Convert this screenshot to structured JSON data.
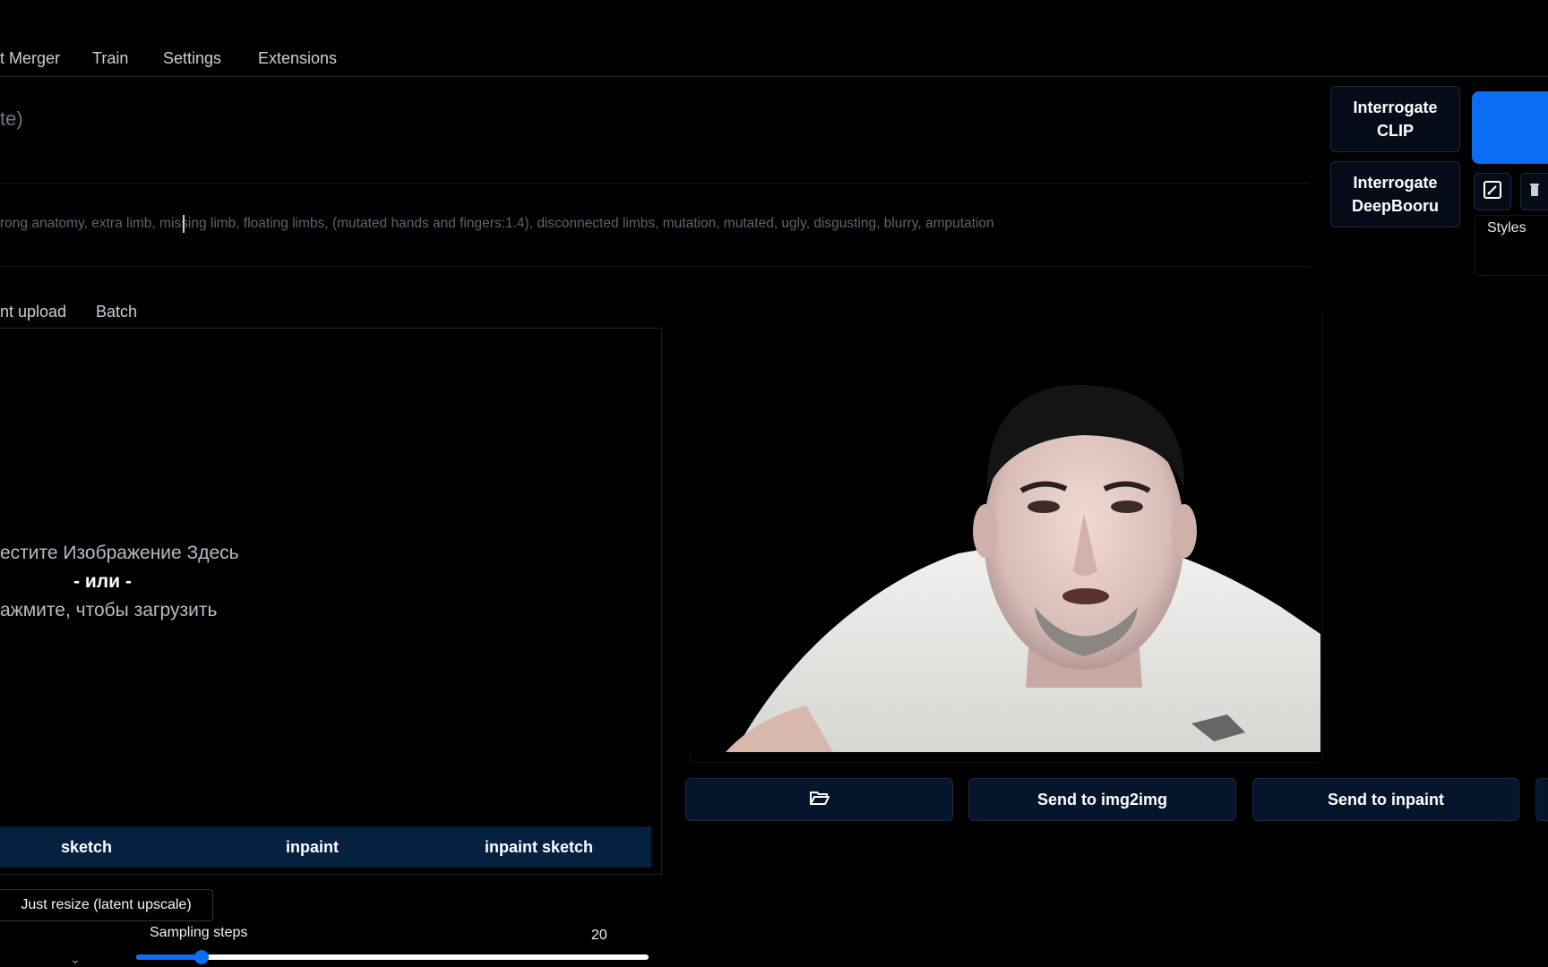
{
  "tabs": [
    {
      "label": "t Merger"
    },
    {
      "label": "Train"
    },
    {
      "label": "Settings"
    },
    {
      "label": "Extensions"
    }
  ],
  "prompt": {
    "placeholder_fragment": "te)",
    "negative_text": "rong anatomy, extra limb, missing limb, floating limbs, (mutated hands and fingers:1.4), disconnected limbs, mutation, mutated, ugly, disgusting, blurry, amputation"
  },
  "interrogate": {
    "clip_line1": "Interrogate",
    "clip_line2": "CLIP",
    "deepbooru_line1": "Interrogate",
    "deepbooru_line2": "DeepBooru"
  },
  "styles": {
    "label": "Styles"
  },
  "source_tabs": [
    {
      "label": "nt upload"
    },
    {
      "label": "Batch"
    }
  ],
  "upload": {
    "line1": "естите Изображение Здесь",
    "line2": "- или -",
    "line3": "ажмите, чтобы загрузить"
  },
  "modes": [
    {
      "label": "sketch"
    },
    {
      "label": "inpaint"
    },
    {
      "label": "inpaint sketch"
    }
  ],
  "output_actions": {
    "send_img2img": "Send to img2img",
    "send_inpaint": "Send to inpaint"
  },
  "resize": {
    "label": "Just resize (latent upscale)"
  },
  "sampling": {
    "label": "Sampling steps",
    "value": "20",
    "min": 1,
    "max": 150,
    "current": 20
  },
  "colors": {
    "accent": "#0b6cf4",
    "background": "#000000",
    "button_bg": "#05152c"
  },
  "icons": [
    "folder-open-icon",
    "edit-icon",
    "trash-icon",
    "chevron-down-icon"
  ]
}
